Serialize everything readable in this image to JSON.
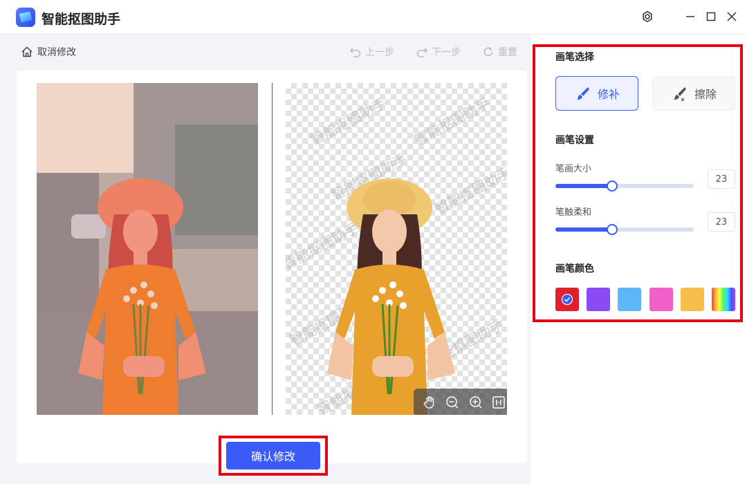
{
  "app": {
    "title": "智能抠图助手"
  },
  "toolbar": {
    "cancel_label": "取消修改",
    "undo_label": "上一步",
    "redo_label": "下一步",
    "reset_label": "重置"
  },
  "canvas": {
    "watermark_text": "智能抠图助手"
  },
  "actions": {
    "confirm_label": "确认修改"
  },
  "settings": {
    "brush_section_title": "画笔选择",
    "brush_repair_label": "修补",
    "brush_erase_label": "擦除",
    "brush_settings_title": "画笔设置",
    "size_label": "笔画大小",
    "size_value": "23",
    "size_fraction": 0.41,
    "softness_label": "笔触柔和",
    "softness_value": "23",
    "softness_fraction": 0.41,
    "color_section_title": "画笔颜色",
    "colors": [
      "#e0202a",
      "#8a4bf5",
      "#5fb6f7",
      "#f05fc8",
      "#f5bd4a",
      "rainbow"
    ],
    "selected_color_index": 0
  }
}
